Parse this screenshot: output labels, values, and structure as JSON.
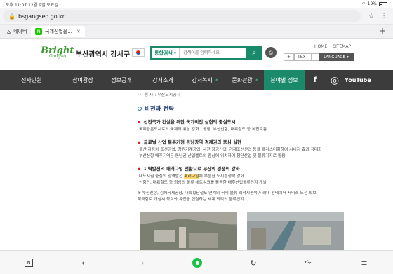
{
  "status": {
    "time_date": "오후 11:07   12월 9일 토요일",
    "battery": "19%"
  },
  "browser": {
    "url": "bsgangseo.go.kr",
    "tabs": [
      {
        "label": "네이버",
        "favicon": "N"
      },
      {
        "label": "국제신업물...",
        "favicon": "N"
      }
    ]
  },
  "site": {
    "logo_text": "Bright",
    "logo_sub": "Gangseo",
    "title": "부산광역시 강서구",
    "search": {
      "scope": "통합검색",
      "placeholder": "검색어를 입력하세요"
    },
    "top_links": [
      "HOME",
      "SITEMAP"
    ],
    "font_controls": [
      "+",
      "TEXT",
      "−"
    ],
    "language": "LANGUAGE"
  },
  "nav": {
    "items": [
      "전자민원",
      "참여광장",
      "정보공개",
      "강서소개",
      "강서복지",
      "문화관광",
      "분야별 정보"
    ],
    "social": [
      "f",
      "YouTube"
    ]
  },
  "content": {
    "breadcrumb": "·시 행 자 : 부산도시공사",
    "section_title": "비전과 전략",
    "items": [
      {
        "title": "선진국가 건설을 위한 국가비전 실현의 중심도시",
        "body": [
          "국제관문도시로의 국제적 위상 강화 : 공항, 부산신항, 대륙철도 등 복합교통"
        ]
      },
      {
        "title": "글로벌 산업 물류거점 동남광역 경제권의 중심 실현",
        "body": [
          "물산 자동차·조선공업, 창원기계공업, 사천 항공산업, 거제조선산업 등을 클러스터화하여 시너지 효과 극대화",
          "부산신항 배후지역은 동남권 산업벨트의 중심에 위치하여 첨단산업 및 물류기지로 활용"
        ]
      },
      {
        "title": "지역발전의 패러다임 전환으로 부산의 경쟁력 강화",
        "body_pre": "대도시권 중심의 광역발전 ",
        "body_hl": "패러다임",
        "body_post": "에 부응한 도시경쟁력 강화",
        "body2": "신항만, 대륙철도 등 최상의 물류 네트워크를 활용한 배후산업물류단지 개발"
      }
    ],
    "note": [
      "※ 부산신항, 김해국제공항, 대륙횡단철도 연계의 국제 물류 최적지동북아 최대 컨테이너 서비스 노선 확보",
      "북극항로 개설시 북미와 유럽을 연결하는 세계 최적의 물류입지"
    ]
  },
  "colors": {
    "brand_green": "#1b8a6b",
    "nav_bg": "#3c3c3c",
    "logo_green": "#3a9a2e"
  }
}
